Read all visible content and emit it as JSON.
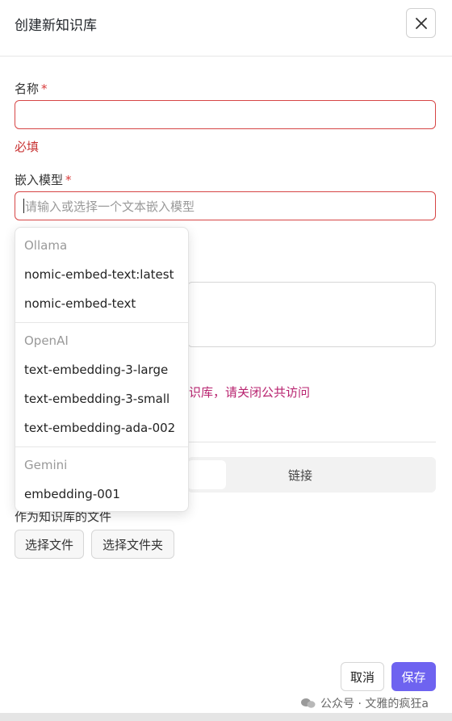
{
  "dialog": {
    "title": "创建新知识库",
    "close_icon": "close-icon"
  },
  "form": {
    "name_label": "名称",
    "required_mark": "*",
    "name_value": "",
    "name_error": "必填",
    "embed_label": "嵌入模型",
    "embed_placeholder": "请输入或选择一个文本嵌入模型",
    "warning_fragment": "识库，请关闭公共访问",
    "segment_link_label": "链接",
    "files_label": "作为知识库的文件",
    "choose_file_label": "选择文件",
    "choose_folder_label": "选择文件夹"
  },
  "dropdown": {
    "groups": [
      {
        "title": "Ollama",
        "options": [
          "nomic-embed-text:latest",
          "nomic-embed-text"
        ]
      },
      {
        "title": "OpenAI",
        "options": [
          "text-embedding-3-large",
          "text-embedding-3-small",
          "text-embedding-ada-002"
        ]
      },
      {
        "title": "Gemini",
        "options": [
          "embedding-001"
        ]
      }
    ]
  },
  "footer": {
    "cancel_label": "取消",
    "save_label": "保存"
  },
  "watermark": {
    "text": "公众号 · 文雅的疯狂a"
  },
  "colors": {
    "error": "#d64545",
    "warning": "#b8236f",
    "primary": "#6e63f0"
  }
}
